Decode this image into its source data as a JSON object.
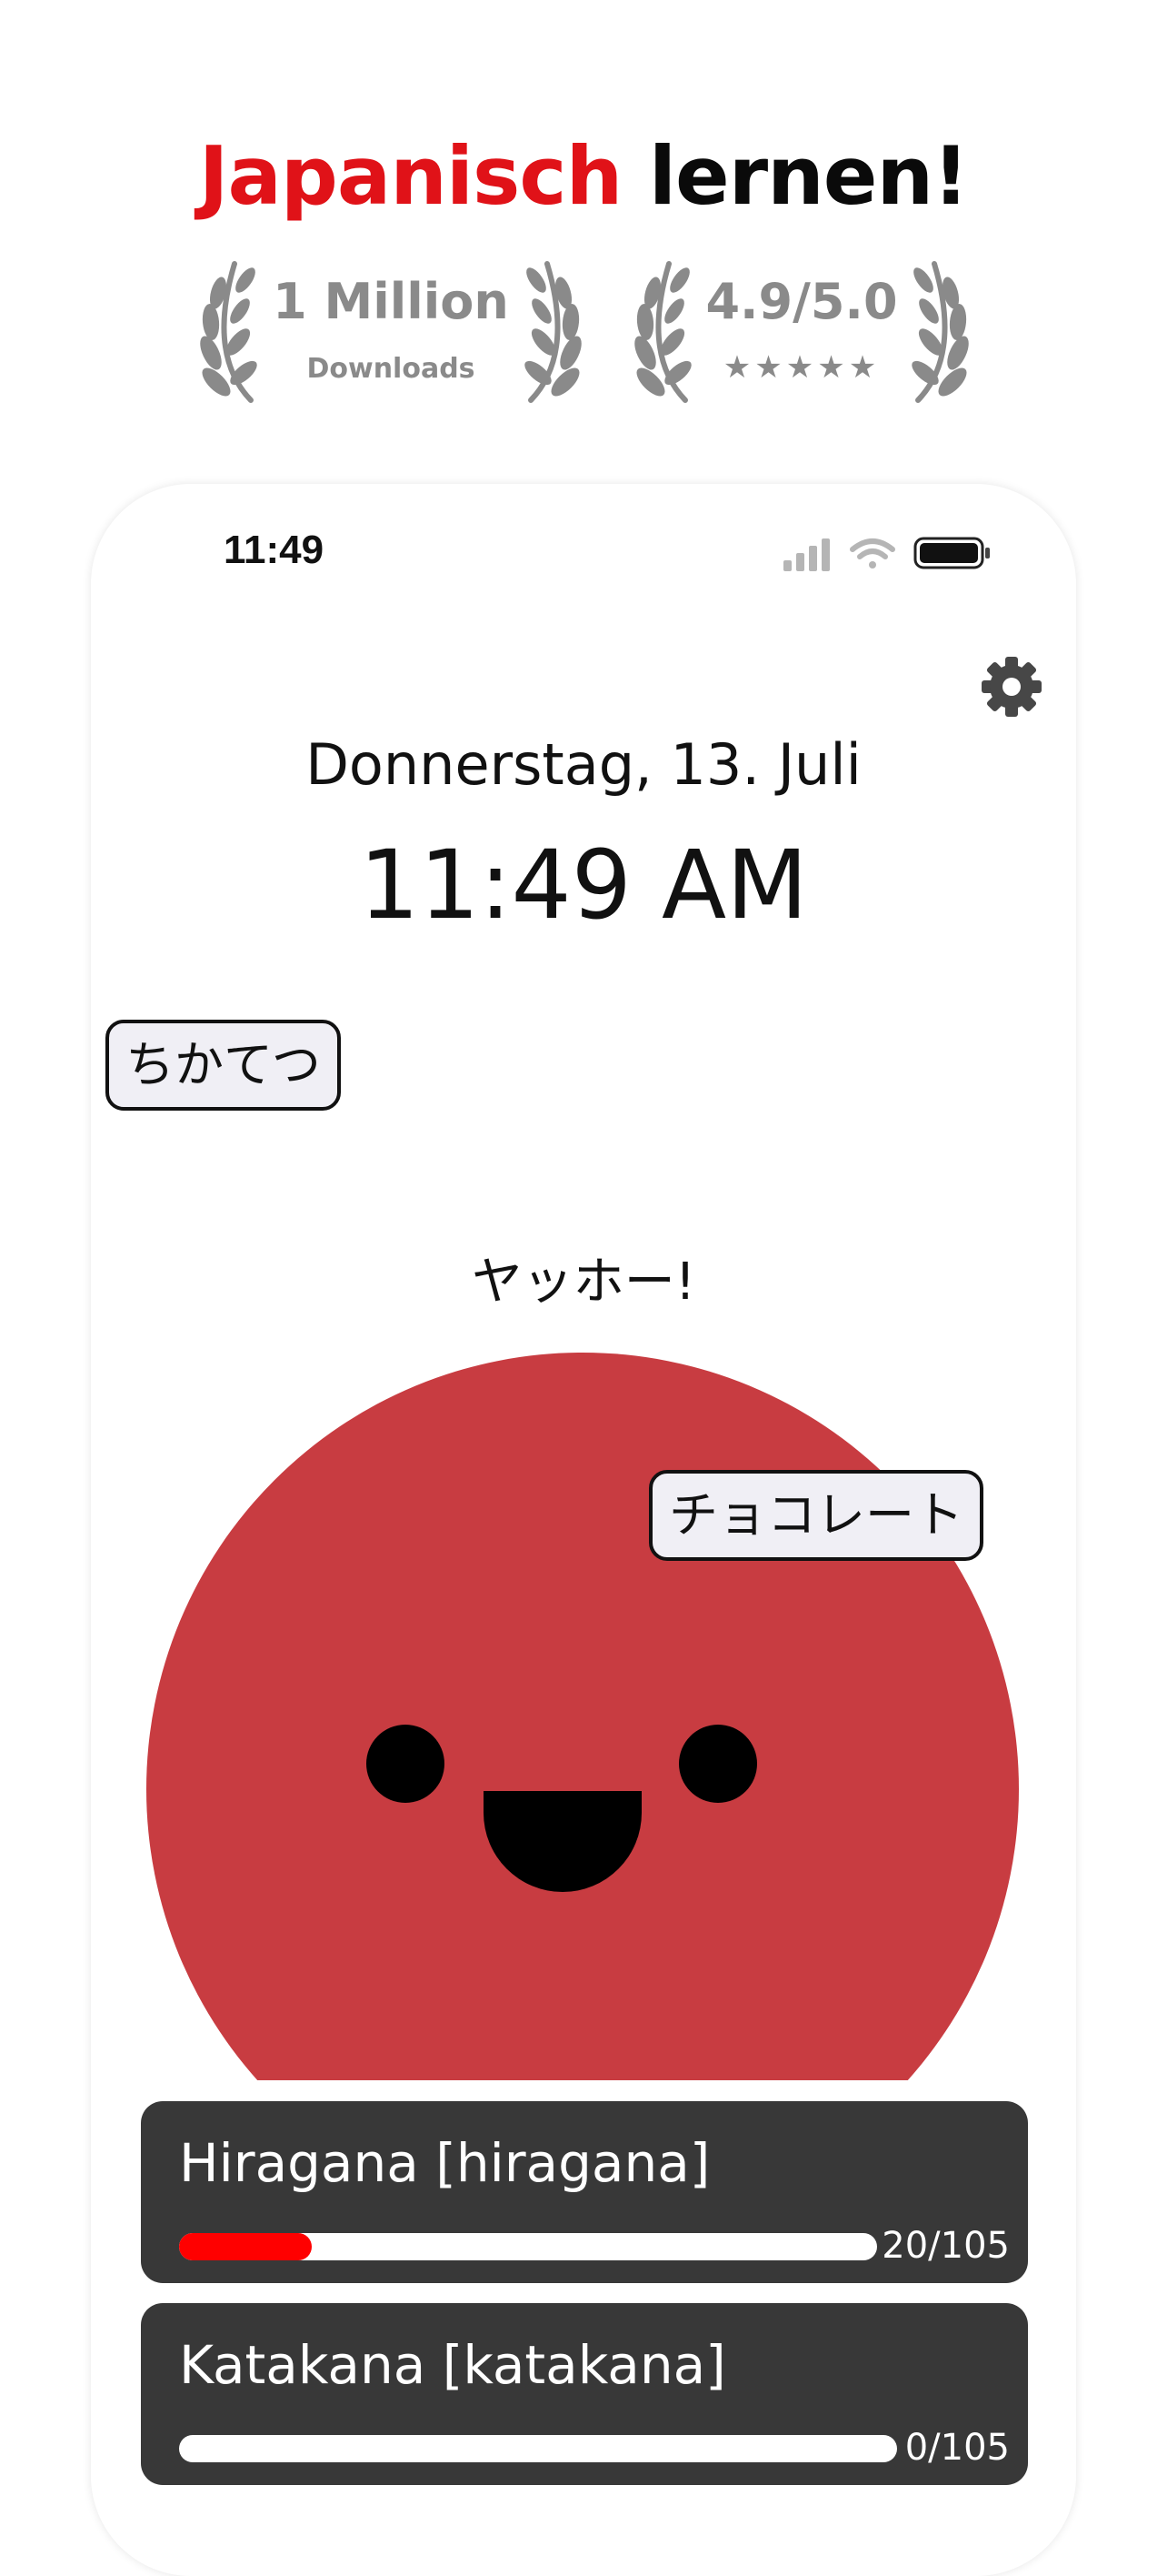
{
  "header": {
    "title_accent": "Japanisch",
    "title_rest": "lernen!"
  },
  "badges": {
    "downloads": {
      "title": "1 Million",
      "subtitle": "Downloads"
    },
    "rating": {
      "title": "4.9/5.0",
      "stars": "★★★★★",
      "value": 4.9,
      "max": 5.0
    }
  },
  "phone": {
    "status_time": "11:49",
    "date": "Donnerstag, 13. Juli",
    "clock": "11:49 AM",
    "floating_words": [
      "ちかてつ",
      "チョコレート"
    ],
    "greeting": "ヤッホー!",
    "mascot_color": "#c83c41",
    "cards": [
      {
        "title": "Hiragana [hiragana]",
        "count": "20/105",
        "progress": 0.19
      },
      {
        "title": "Katakana [katakana]",
        "count": "0/105",
        "progress": 0.0
      }
    ]
  },
  "colors": {
    "accent": "#e01218",
    "progress_fill": "#ff0000",
    "card_bg": "#383838",
    "badge_gray": "#8a8a8a"
  },
  "icons": {
    "settings": "gear-icon",
    "signal": "cellular-signal-icon",
    "wifi": "wifi-icon",
    "battery": "battery-icon",
    "laurel": "laurel-wreath-icon"
  }
}
